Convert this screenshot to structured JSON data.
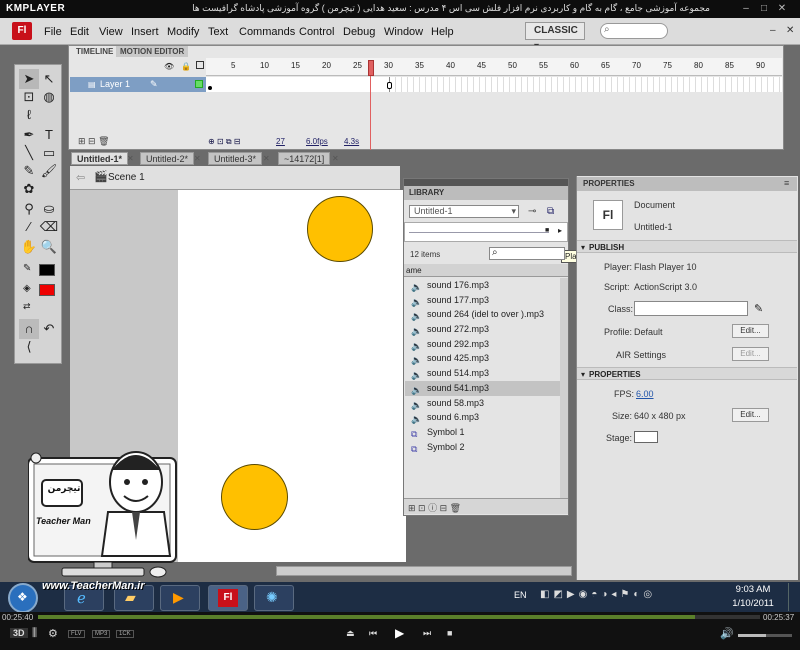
{
  "player": {
    "logo": "KMPLAYER",
    "video_title": "مجموعه آموزشی جامع ، گام به گام و کاربردی نرم افزار فلش سی اس ۴ مدرس : سعید هدایی ( تیچرمن ) گروه آموزشی پادشاه گرافیست ها",
    "time_elapsed": "00:25:40",
    "time_total": "00:25:37",
    "progress": 0.91,
    "badges": [
      "FLV",
      "MP3",
      "1CK"
    ]
  },
  "app": {
    "logo_text": "Fl",
    "menu": [
      "File",
      "Edit",
      "View",
      "Insert",
      "Modify",
      "Text",
      "Commands",
      "Control",
      "Debug",
      "Window",
      "Help"
    ],
    "workspace": "CLASSIC"
  },
  "timeline": {
    "tabs": [
      "TIMELINE",
      "MOTION EDITOR"
    ],
    "frame_numbers": [
      "5",
      "10",
      "15",
      "20",
      "25",
      "30",
      "35",
      "40",
      "45",
      "50",
      "55",
      "60",
      "65",
      "70",
      "75",
      "80",
      "85",
      "90"
    ],
    "layer_name": "Layer 1",
    "current_frame": "27",
    "fps": "6.0fps",
    "time": "4.3s",
    "playhead_frame": 27
  },
  "documents": {
    "tabs": [
      "Untitled-1*",
      "Untitled-2*",
      "Untitled-3*",
      "~14172[1]"
    ],
    "scene": "Scene 1"
  },
  "library": {
    "title": "LIBRARY",
    "document": "Untitled-1",
    "count": "12 items",
    "column_header": "ame",
    "tooltip": "Play",
    "items": [
      {
        "name": "sound 176.mp3",
        "type": "sound"
      },
      {
        "name": "sound 177.mp3",
        "type": "sound"
      },
      {
        "name": "sound 264 (idel to over ).mp3",
        "type": "sound"
      },
      {
        "name": "sound 272.mp3",
        "type": "sound"
      },
      {
        "name": "sound 292.mp3",
        "type": "sound"
      },
      {
        "name": "sound 425.mp3",
        "type": "sound"
      },
      {
        "name": "sound 514.mp3",
        "type": "sound"
      },
      {
        "name": "sound 541.mp3",
        "type": "sound"
      },
      {
        "name": "sound 58.mp3",
        "type": "sound"
      },
      {
        "name": "sound 6.mp3",
        "type": "sound"
      },
      {
        "name": "Symbol 1",
        "type": "symbol"
      },
      {
        "name": "Symbol 2",
        "type": "symbol"
      }
    ],
    "selected_index": 7
  },
  "properties": {
    "title": "PROPERTIES",
    "doc_icon": "Fl",
    "doc_type": "Document",
    "doc_name": "Untitled-1",
    "publish_section": "PUBLISH",
    "player_label": "Player:",
    "player_value": "Flash Player 10",
    "script_label": "Script:",
    "script_value": "ActionScript 3.0",
    "class_label": "Class:",
    "profile_label": "Profile:",
    "profile_value": "Default",
    "air_label": "AIR Settings",
    "edit_label": "Edit...",
    "properties_section": "PROPERTIES",
    "fps_label": "FPS:",
    "fps_value": "6.00",
    "size_label": "Size:",
    "size_value": "640 x 480 px",
    "stage_label": "Stage:"
  },
  "watermark": {
    "brand_fa": "تیچرمن",
    "brand_en": "Teacher Man",
    "url": "www.TeacherMan.ir"
  },
  "taskbar": {
    "language": "EN",
    "time": "9:03 AM",
    "date": "1/10/2011"
  },
  "colors": {
    "circle_fill": "#ffc000",
    "flash_red": "#c8101a",
    "layer_highlight": "#7e9ec4"
  }
}
